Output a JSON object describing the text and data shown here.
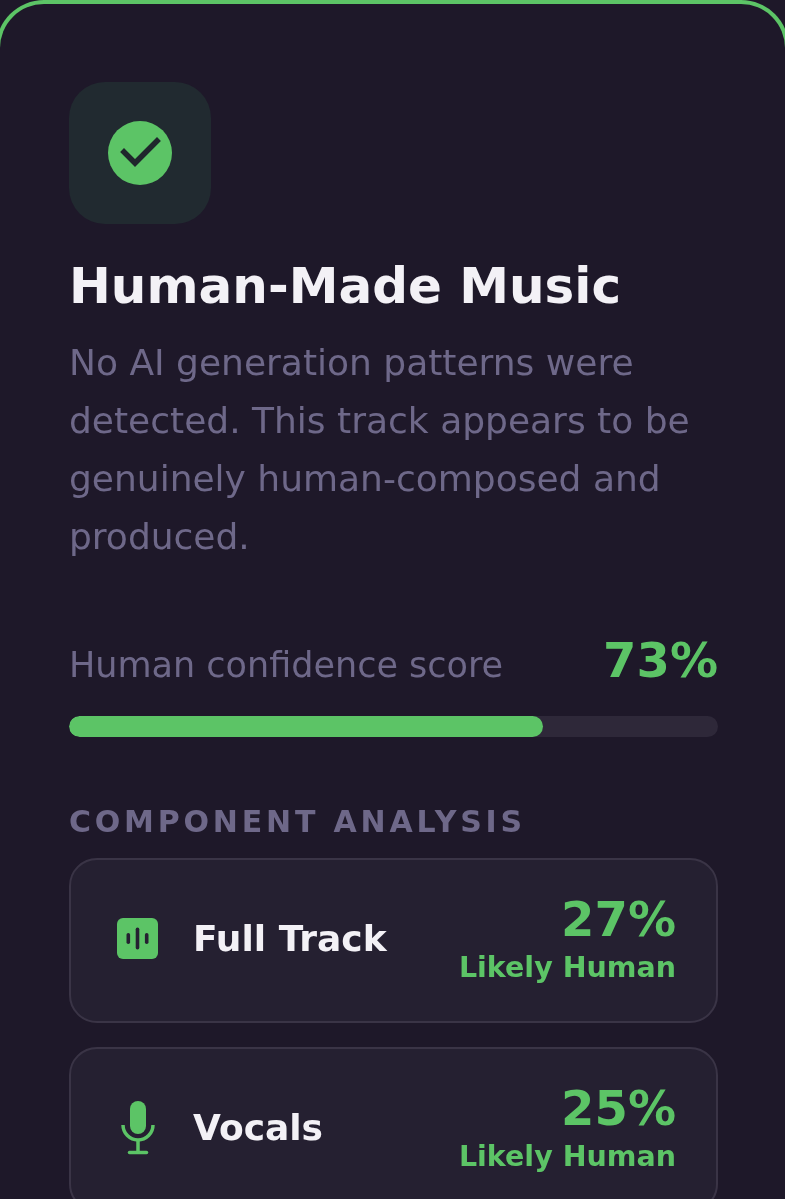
{
  "result": {
    "ai_detected": false,
    "title": "Human-Made Music",
    "description": "No AI generation patterns were detected. This track appears to be genuinely human-composed and produced."
  },
  "confidence": {
    "label": "Human confidence score",
    "value": "73%",
    "level": 0.73
  },
  "component_analysis": {
    "heading": "COMPONENT ANALYSIS",
    "components": [
      {
        "kind": "full-track",
        "name": "Full Track",
        "score": "27%",
        "verdict": "Likely Human"
      },
      {
        "kind": "vocals",
        "name": "Vocals",
        "score": "25%",
        "verdict": "Likely Human"
      }
    ]
  }
}
